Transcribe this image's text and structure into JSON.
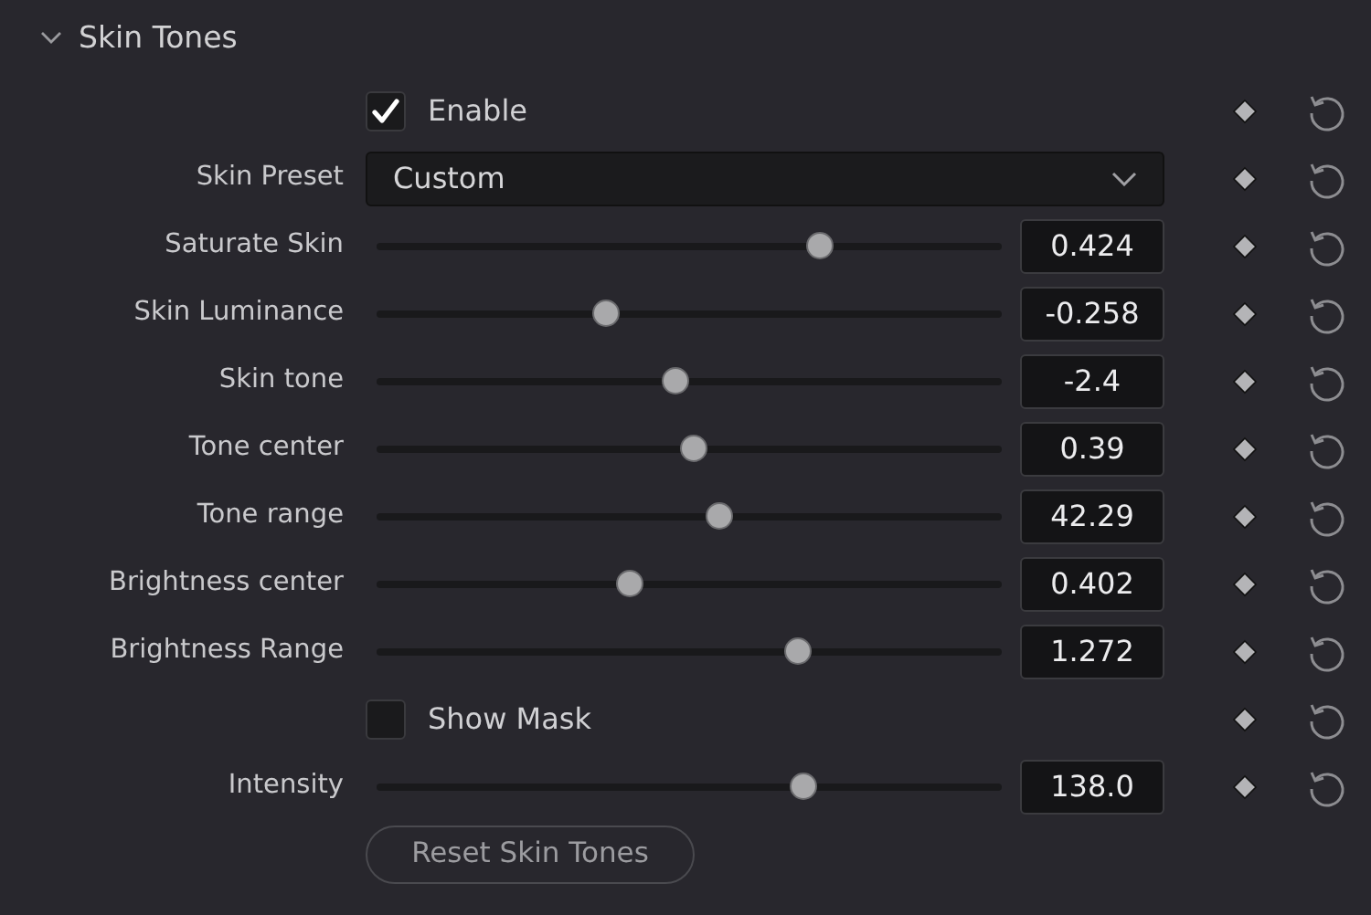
{
  "section": {
    "title": "Skin Tones",
    "expanded": true
  },
  "rows": [
    {
      "kind": "checkbox",
      "label": "Enable",
      "checked": true
    },
    {
      "kind": "dropdown",
      "label": "Skin Preset",
      "value": "Custom"
    },
    {
      "kind": "slider",
      "label": "Saturate Skin",
      "level": 0.71,
      "reading": "0.424"
    },
    {
      "kind": "slider",
      "label": "Skin Luminance",
      "level": 0.368,
      "reading": "-0.258"
    },
    {
      "kind": "slider",
      "label": "Skin tone",
      "level": 0.477,
      "reading": "-2.4"
    },
    {
      "kind": "slider",
      "label": "Tone center",
      "level": 0.506,
      "reading": "0.39"
    },
    {
      "kind": "slider",
      "label": "Tone range",
      "level": 0.547,
      "reading": "42.29"
    },
    {
      "kind": "slider",
      "label": "Brightness center",
      "level": 0.404,
      "reading": "0.402"
    },
    {
      "kind": "slider",
      "label": "Brightness Range",
      "level": 0.675,
      "reading": "1.272"
    },
    {
      "kind": "checkbox",
      "label": "Show Mask",
      "checked": false
    },
    {
      "kind": "slider",
      "label": "Intensity",
      "level": 0.684,
      "reading": "138.0"
    }
  ],
  "reset_button": "Reset Skin Tones"
}
